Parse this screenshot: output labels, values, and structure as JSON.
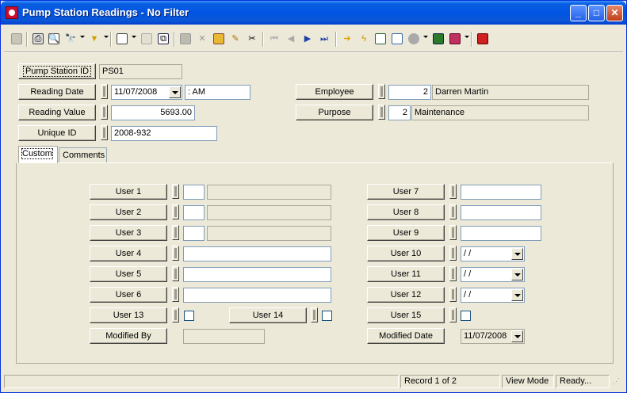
{
  "window": {
    "title": "Pump Station Readings - No Filter"
  },
  "titlebar_buttons": {
    "minimize": "_",
    "maximize": "□",
    "close": "✕"
  },
  "header_fields": {
    "pump_station_id": {
      "label": "Pump Station ID",
      "value": "PS01"
    },
    "reading_date": {
      "label": "Reading Date",
      "value": "11/07/2008",
      "time": " :  AM"
    },
    "reading_value": {
      "label": "Reading Value",
      "value": "5693.00"
    },
    "unique_id": {
      "label": "Unique ID",
      "value": "2008-932"
    },
    "employee": {
      "label": "Employee",
      "number": "2",
      "name": "Darren Martin"
    },
    "purpose": {
      "label": "Purpose",
      "number": "2",
      "name": "Maintenance"
    }
  },
  "tabs": [
    {
      "label": "Custom"
    },
    {
      "label": "Comments"
    }
  ],
  "custom": {
    "user1": {
      "label": "User 1"
    },
    "user2": {
      "label": "User 2"
    },
    "user3": {
      "label": "User 3"
    },
    "user4": {
      "label": "User 4"
    },
    "user5": {
      "label": "User 5"
    },
    "user6": {
      "label": "User 6"
    },
    "user7": {
      "label": "User 7"
    },
    "user8": {
      "label": "User 8"
    },
    "user9": {
      "label": "User 9"
    },
    "user10": {
      "label": "User 10",
      "value": " / /"
    },
    "user11": {
      "label": "User 11",
      "value": " / /"
    },
    "user12": {
      "label": "User 12",
      "value": " / /"
    },
    "user13": {
      "label": "User 13"
    },
    "user14": {
      "label": "User 14"
    },
    "user15": {
      "label": "User 15"
    },
    "modified_by": {
      "label": "Modified By",
      "value": ""
    },
    "modified_date": {
      "label": "Modified Date",
      "value": "11/07/2008"
    }
  },
  "status_bar": {
    "record": "Record 1 of 2",
    "mode": "View Mode",
    "state": "Ready..."
  },
  "toolbar_icons": [
    "grid-icon",
    "print-icon",
    "print-preview-icon",
    "find-icon",
    "filter-icon",
    "new-record-icon",
    "copy-record-icon",
    "save-icon",
    "delete-icon",
    "spellcheck-icon",
    "edit-icon",
    "cut-icon",
    "first-record-icon",
    "previous-record-icon",
    "next-record-icon",
    "last-record-icon",
    "goto-icon",
    "lightning-icon",
    "report-icon",
    "tree-icon",
    "globe-icon",
    "calculator-icon",
    "book-icon",
    "exit-icon"
  ],
  "colors": {
    "titlebar": "#0054E3",
    "window": "#ECE9D8",
    "nav_blue": "#1C3FA8"
  }
}
